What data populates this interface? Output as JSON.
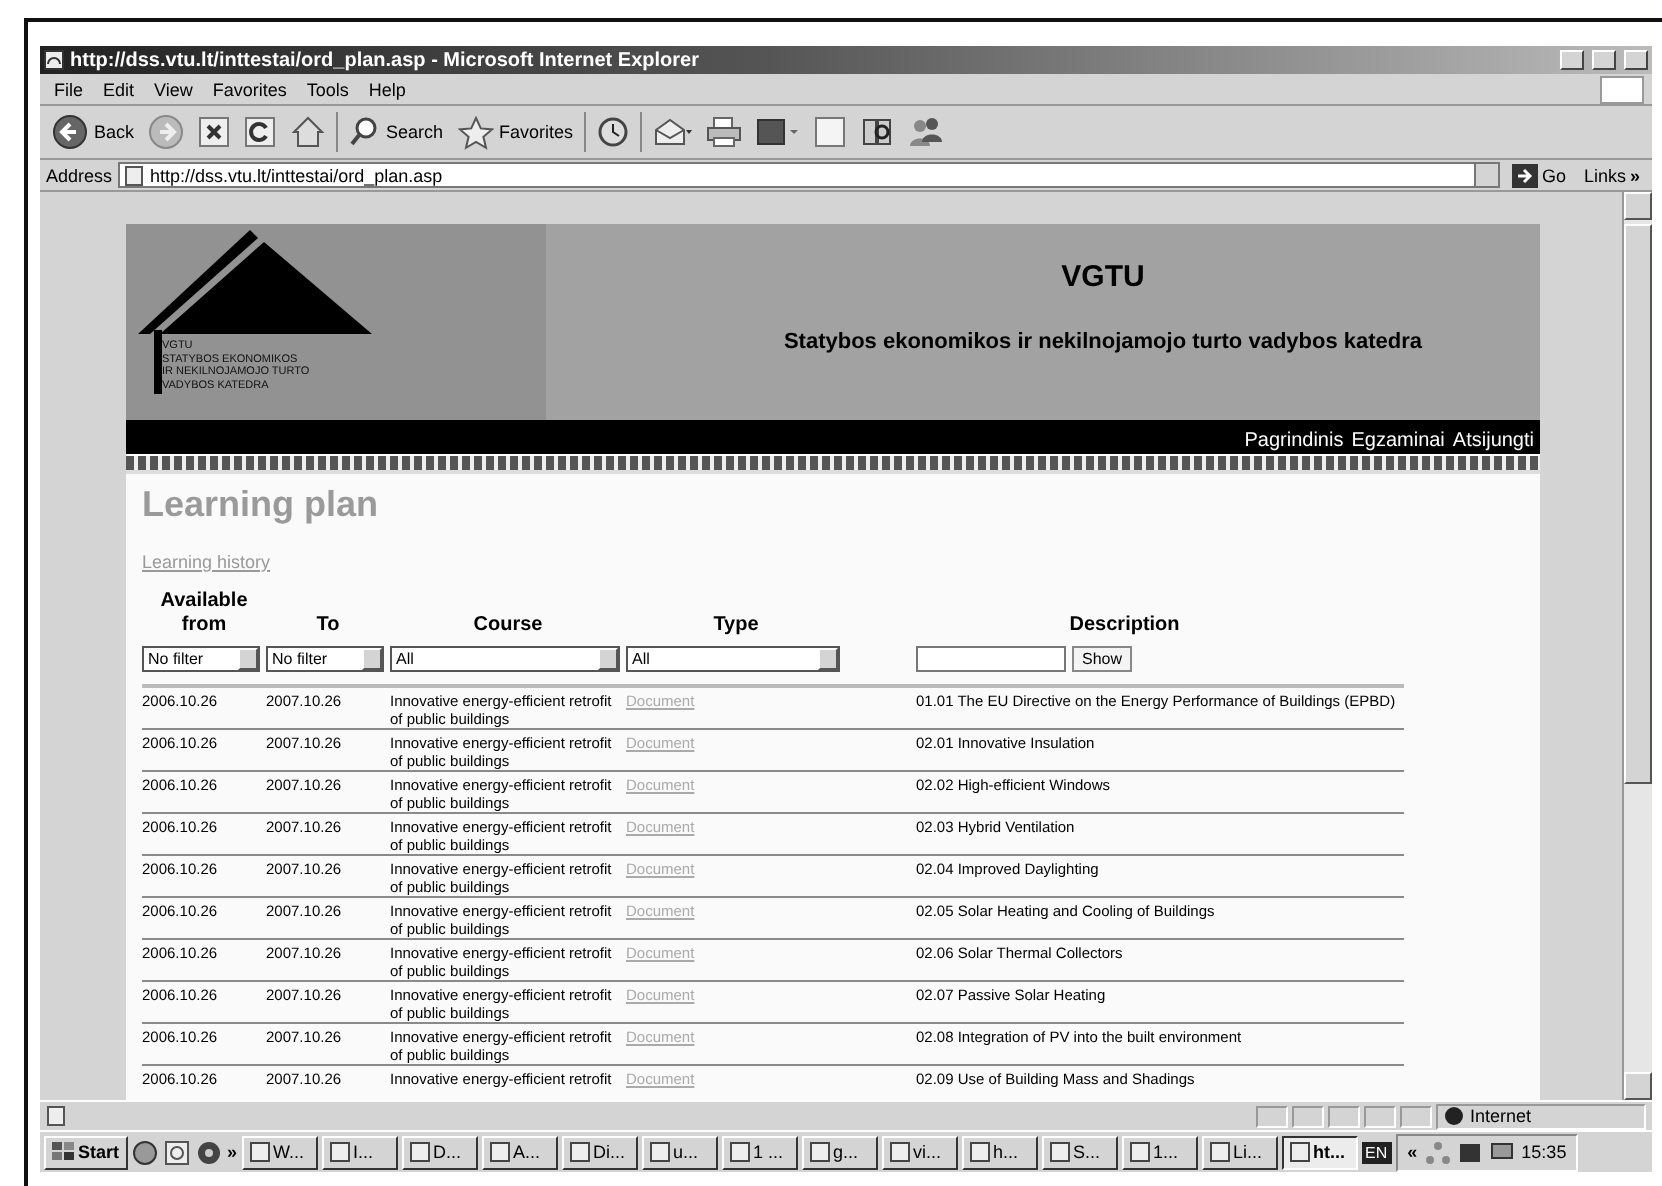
{
  "window": {
    "title": "http://dss.vtu.lt/inttestai/ord_plan.asp - Microsoft Internet Explorer"
  },
  "menu": [
    "File",
    "Edit",
    "View",
    "Favorites",
    "Tools",
    "Help"
  ],
  "toolbar": [
    {
      "kind": "back",
      "label": "Back"
    },
    {
      "kind": "forward"
    },
    {
      "kind": "stop"
    },
    {
      "kind": "refresh"
    },
    {
      "kind": "home"
    },
    {
      "kind": "search",
      "label": "Search"
    },
    {
      "kind": "favorites",
      "label": "Favorites"
    },
    {
      "kind": "history"
    },
    {
      "kind": "mail"
    },
    {
      "kind": "print"
    },
    {
      "kind": "edit"
    },
    {
      "kind": "discuss"
    },
    {
      "kind": "research"
    },
    {
      "kind": "messenger"
    }
  ],
  "address": {
    "label": "Address",
    "value": "http://dss.vtu.lt/inttestai/ord_plan.asp",
    "go": "Go",
    "links": "Links",
    "links_more": "»"
  },
  "header": {
    "logo_lines": [
      "VGTU",
      "STATYBOS EKONOMIKOS",
      "IR NEKILNOJAMOJO TURTO",
      "VADYBOS KATEDRA"
    ],
    "title": "VGTU",
    "subtitle": "Statybos ekonomikos ir nekilnojamojo turto vadybos katedra",
    "nav": [
      "Pagrindinis",
      "Egzaminai",
      "Atsijungti"
    ]
  },
  "page": {
    "heading": "Learning plan",
    "history_link": "Learning history"
  },
  "table": {
    "columns": [
      "Available from",
      "To",
      "Course",
      "Type",
      "Description"
    ],
    "filters": [
      {
        "kind": "select",
        "value": "No filter"
      },
      {
        "kind": "select",
        "value": "No filter"
      },
      {
        "kind": "select",
        "value": "All"
      },
      {
        "kind": "select",
        "value": "All"
      },
      {
        "kind": "text"
      },
      {
        "kind": "button",
        "label": "Show"
      }
    ],
    "rows": [
      {
        "from": "2006.10.26",
        "to": "2007.10.26",
        "course": "Innovative energy-efficient retrofit of public buildings",
        "type": "Document",
        "description": "01.01 The EU Directive on the Energy Performance of Buildings (EPBD)"
      },
      {
        "from": "2006.10.26",
        "to": "2007.10.26",
        "course": "Innovative energy-efficient retrofit of public buildings",
        "type": "Document",
        "description": "02.01 Innovative Insulation"
      },
      {
        "from": "2006.10.26",
        "to": "2007.10.26",
        "course": "Innovative energy-efficient retrofit of public buildings",
        "type": "Document",
        "description": "02.02 High-efficient Windows"
      },
      {
        "from": "2006.10.26",
        "to": "2007.10.26",
        "course": "Innovative energy-efficient retrofit of public buildings",
        "type": "Document",
        "description": "02.03 Hybrid Ventilation"
      },
      {
        "from": "2006.10.26",
        "to": "2007.10.26",
        "course": "Innovative energy-efficient retrofit of public buildings",
        "type": "Document",
        "description": "02.04 Improved Daylighting"
      },
      {
        "from": "2006.10.26",
        "to": "2007.10.26",
        "course": "Innovative energy-efficient retrofit of public buildings",
        "type": "Document",
        "description": "02.05 Solar Heating and Cooling of Buildings"
      },
      {
        "from": "2006.10.26",
        "to": "2007.10.26",
        "course": "Innovative energy-efficient retrofit of public buildings",
        "type": "Document",
        "description": "02.06 Solar Thermal Collectors"
      },
      {
        "from": "2006.10.26",
        "to": "2007.10.26",
        "course": "Innovative energy-efficient retrofit of public buildings",
        "type": "Document",
        "description": "02.07 Passive Solar Heating"
      },
      {
        "from": "2006.10.26",
        "to": "2007.10.26",
        "course": "Innovative energy-efficient retrofit of public buildings",
        "type": "Document",
        "description": "02.08 Integration of PV into the built environment"
      },
      {
        "from": "2006.10.26",
        "to": "2007.10.26",
        "course": "Innovative energy-efficient retrofit",
        "type": "Document",
        "description": "02.09 Use of Building Mass and Shadings"
      }
    ]
  },
  "status_bar": {
    "zone": "Internet"
  },
  "taskbar": {
    "start": "Start",
    "more": "»",
    "tasks": [
      {
        "label": "W...",
        "selected": false
      },
      {
        "label": "I...",
        "selected": false
      },
      {
        "label": "D...",
        "selected": false
      },
      {
        "label": "A...",
        "selected": false
      },
      {
        "label": "Di...",
        "selected": false
      },
      {
        "label": "u...",
        "selected": false
      },
      {
        "label": "1 ...",
        "selected": false
      },
      {
        "label": "g...",
        "selected": false
      },
      {
        "label": "vi...",
        "selected": false
      },
      {
        "label": "h...",
        "selected": false
      },
      {
        "label": "S...",
        "selected": false
      },
      {
        "label": "1...",
        "selected": false
      },
      {
        "label": "Li...",
        "selected": false
      },
      {
        "label": "ht...",
        "selected": true
      }
    ],
    "language": "EN",
    "tray_more": "«",
    "clock": "15:35"
  }
}
